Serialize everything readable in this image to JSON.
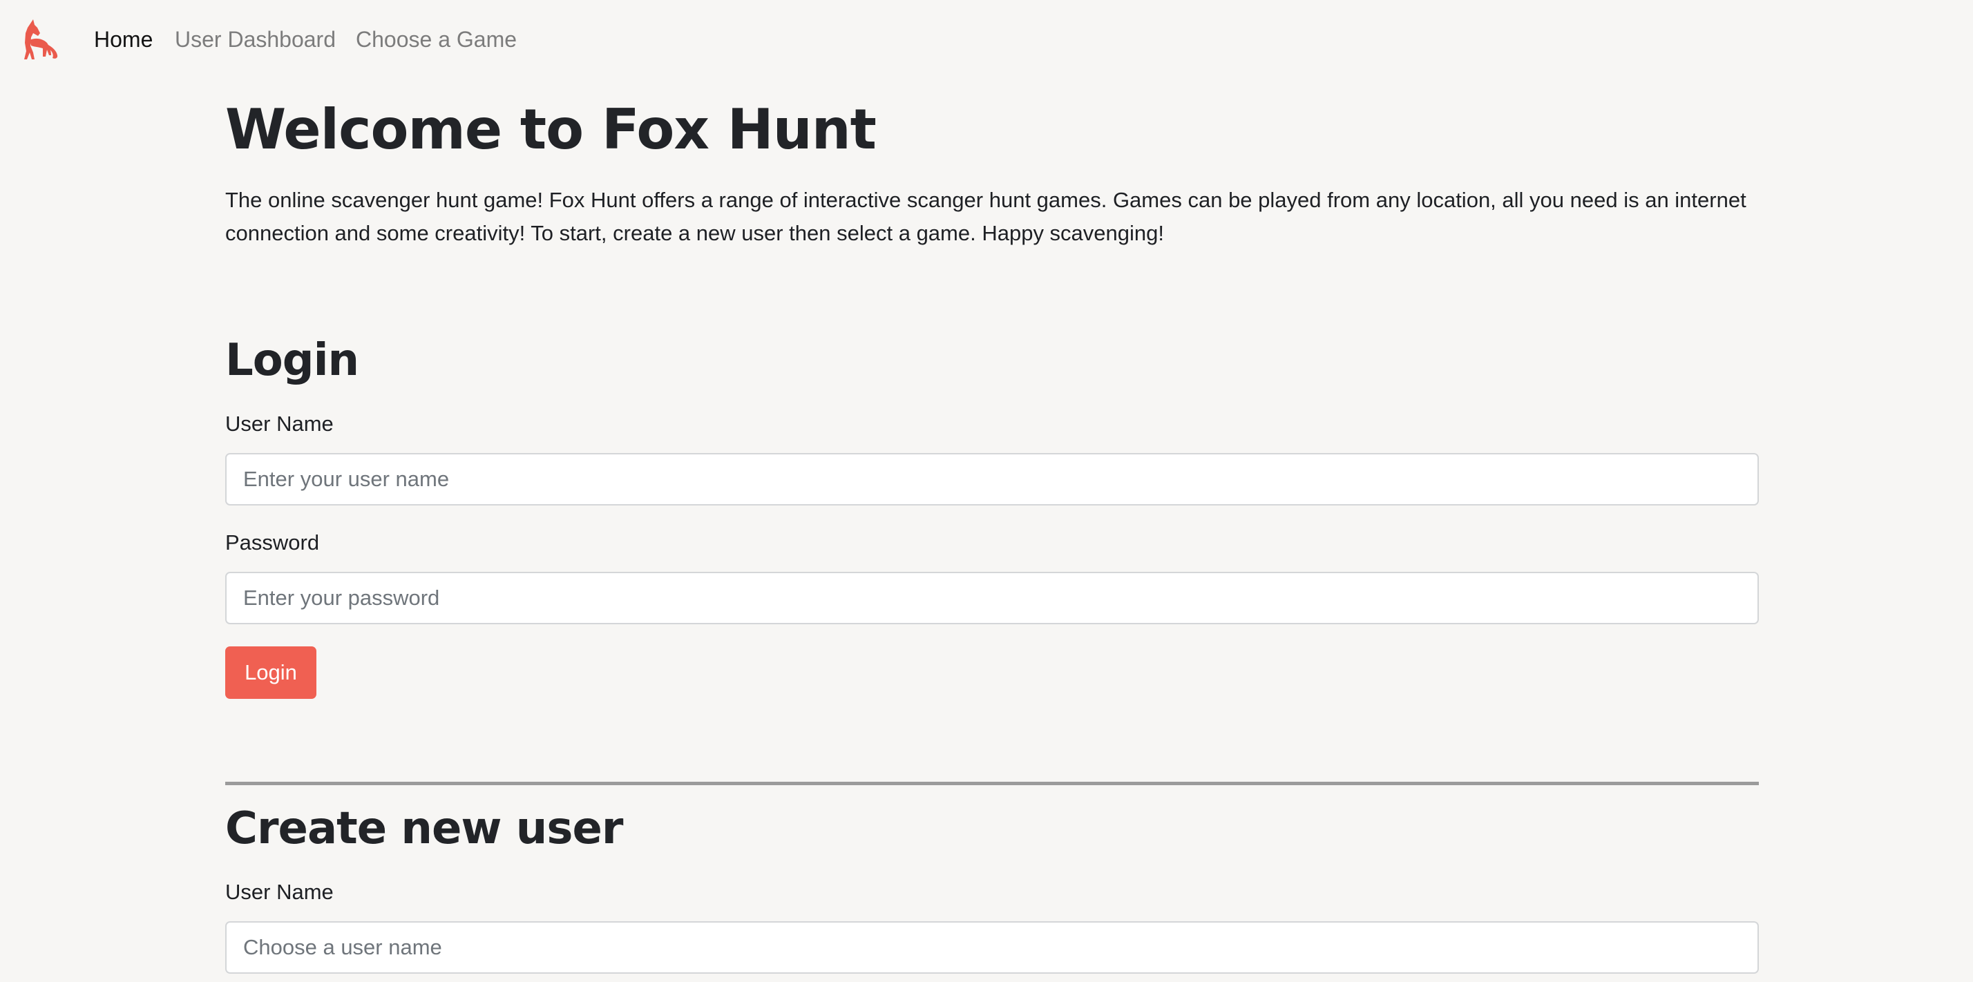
{
  "nav": {
    "logo_icon": "fox-logo-icon",
    "accent_color": "#f06052",
    "links": [
      {
        "label": "Home",
        "active": true
      },
      {
        "label": "User Dashboard",
        "active": false
      },
      {
        "label": "Choose a Game",
        "active": false
      }
    ]
  },
  "welcome": {
    "title": "Welcome to Fox Hunt",
    "intro": "The online scavenger hunt game! Fox Hunt offers a range of interactive scanger hunt games. Games can be played from any location, all you need is an internet connection and some creativity! To start, create a new user then select a game. Happy scavenging!"
  },
  "login": {
    "title": "Login",
    "username_label": "User Name",
    "username_placeholder": "Enter your user name",
    "password_label": "Password",
    "password_placeholder": "Enter your password",
    "button_label": "Login"
  },
  "create_user": {
    "title": "Create new user",
    "username_label": "User Name",
    "username_placeholder": "Choose a user name"
  }
}
